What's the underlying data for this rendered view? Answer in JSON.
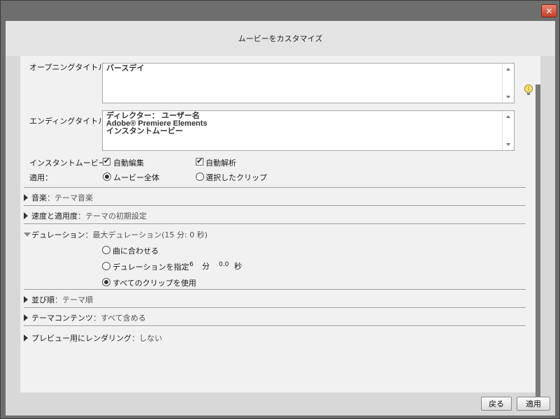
{
  "window": {
    "title": "ムービーをカスタマイズ"
  },
  "opening_title": {
    "label": "オープニングタイトル：",
    "value": "バースデイ"
  },
  "ending_title": {
    "label": "エンディングタイトル：",
    "lines": [
      "ディレクター： ユーザー名",
      "Adobe® Premiere Elements",
      "インスタントムービー"
    ]
  },
  "instant_movie": {
    "label": "インスタントムービー：",
    "auto_edit": {
      "label": "自動編集",
      "checked": true
    },
    "auto_analyze": {
      "label": "自動解析",
      "checked": true
    }
  },
  "apply": {
    "label": "適用：",
    "whole_movie": {
      "label": "ムービー全体",
      "selected": true
    },
    "selected_clips": {
      "label": "選択したクリップ",
      "selected": false
    }
  },
  "sections": {
    "music": {
      "label": "音楽",
      "value": "：テーマ音楽",
      "expanded": false
    },
    "speed": {
      "label": "速度と適用度",
      "value": "：テーマの初期設定",
      "expanded": false
    },
    "duration": {
      "label": "デュレーション",
      "value": "：最大デュレーション(15 分: 0 秒)",
      "expanded": true
    },
    "order": {
      "label": "並び順",
      "value": "：テーマ順",
      "expanded": false
    },
    "contents": {
      "label": "テーマコンテンツ",
      "value": "：すべて含める",
      "expanded": false
    },
    "render": {
      "label": "プレビュー用にレンダリング",
      "value": "：しない",
      "expanded": false
    }
  },
  "duration_options": {
    "fit_music": {
      "label": "曲に合わせる",
      "selected": false
    },
    "specify": {
      "label": "デュレーションを指定",
      "selected": false,
      "minutes": "6",
      "minutes_unit": "分",
      "seconds": "0.0",
      "seconds_unit": "秒"
    },
    "all_clips": {
      "label": "すべてのクリップを使用",
      "selected": true
    }
  },
  "buttons": {
    "back": "戻る",
    "apply": "適用"
  },
  "icons": {
    "close": "close-icon",
    "tip": "lightbulb-icon"
  }
}
